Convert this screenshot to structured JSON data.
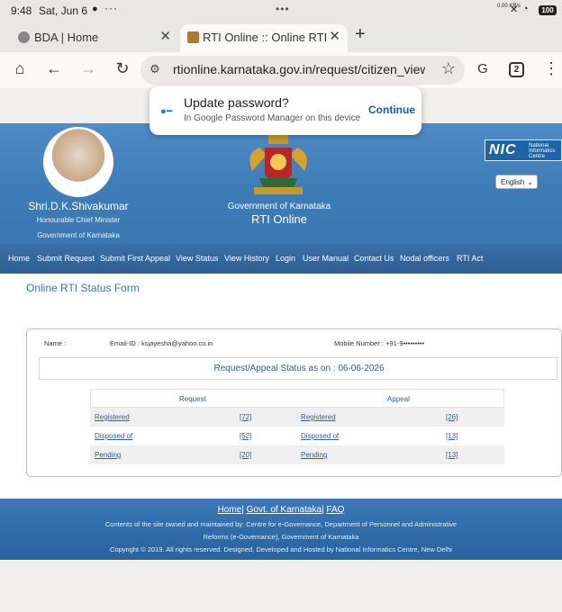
{
  "status_bar": {
    "time": "9:48",
    "date": "Sat, Jun 6",
    "net_speed": "0.00 KB/s",
    "battery": "100"
  },
  "tabs": [
    {
      "title": "BDA | Home"
    },
    {
      "title": "RTI Online :: Online RTI Information System"
    }
  ],
  "toolbar": {
    "url": "rtionline.karnataka.gov.in/request/citizen_view_history",
    "tab_count": "2"
  },
  "password_popup": {
    "title": "Update password?",
    "subtitle": "In Google Password Manager on this device",
    "button": "Continue"
  },
  "header": {
    "cm_name": "Shri.D.K.Shivakumar",
    "cm_role": "Honourable Chief Minister",
    "cm_gov": "Government of Karnataka",
    "gov_title": "Government of Karnataka",
    "site_title": "RTI Online",
    "nic_short": "NIC",
    "nic_full": "National Informatics Centre",
    "language": "English"
  },
  "nav": [
    "Home",
    "Submit Request",
    "Submit First Appeal",
    "View Status",
    "View History",
    "Login",
    "User Manual",
    "Contact Us",
    "Nodal officers",
    "RTI Act"
  ],
  "form": {
    "title": "Online RTI Status Form",
    "name_label": "Name :",
    "email": "Email-ID : ksjayesha@yahoo.co.in",
    "mobile": "Mobile Number : +91-9•••••••••",
    "status_heading": "Request/Appeal Status as on : 06-06-2026"
  },
  "status_table": {
    "headers": {
      "request": "Request",
      "appeal": "Appeal"
    },
    "rows": [
      {
        "label": "Registered",
        "request_count": "[72]",
        "appeal_label": "Registered",
        "appeal_count": "[26]"
      },
      {
        "label": "Disposed of",
        "request_count": "[52]",
        "appeal_label": "Disposed of",
        "appeal_count": "[13]"
      },
      {
        "label": "Pending",
        "request_count": "[20]",
        "appeal_label": "Pending",
        "appeal_count": "[13]"
      }
    ]
  },
  "footer": {
    "links": [
      "Home",
      "Govt. of Karnataka",
      "FAQ"
    ],
    "line1": "Contents of the site owned and maintained by: Centre for e-Governance, Department of Personnel and Administrative",
    "line2": "Reforms (e-Governance), Government of Karnataka",
    "line3": "Copyright © 2019. All rights reserved. Designed, Developed and Hosted by National Informatics Centre, New Delhi"
  }
}
